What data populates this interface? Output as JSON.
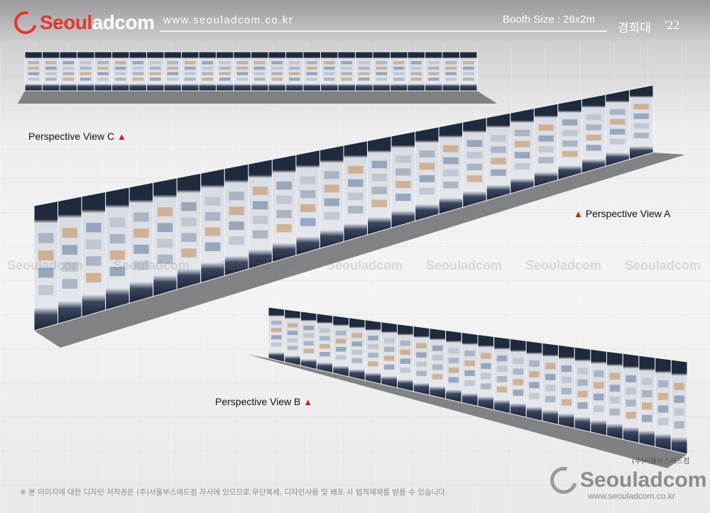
{
  "header": {
    "logo_text_a": "Seoul",
    "logo_text_b": "adcom",
    "site_url": "www.seouladcom.co.kr",
    "booth_size": "Booth Size : 26x2m",
    "university": "경희대",
    "year": "'22"
  },
  "views": {
    "c_label": "Perspective View C",
    "a_label": "Perspective View A",
    "b_label": "Perspective View B"
  },
  "watermark": "Seouladcom",
  "footer": {
    "copyright_note": "※ 본 이미지에 대한 디자인 저작권은 (주)서울부스애드컴 자사에 있으므로 무단복제, 디자인사용 및 배포 시 법적제재를 받을 수 있습니다.",
    "company": "(주)서울부스애드컴",
    "logo_text": "Seouladcom",
    "url": "www.seouladcom.co.kr"
  },
  "colors": {
    "accent": "#e8342c",
    "panel_dark": "#1f2a3d",
    "panel_light": "#dfe3ea"
  },
  "booth": {
    "panel_count": 26
  }
}
